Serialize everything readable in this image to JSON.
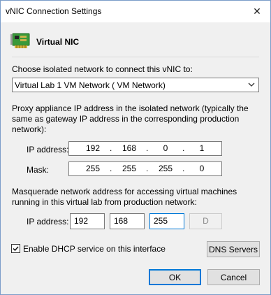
{
  "window": {
    "title": "vNIC Connection Settings",
    "close_glyph": "✕"
  },
  "header": {
    "title": "Virtual NIC",
    "icon": "network-card-icon"
  },
  "isolated_network": {
    "label": "Choose isolated network to connect this vNIC to:",
    "selected": "Virtual Lab 1 VM Network ( VM Network)"
  },
  "proxy": {
    "description": "Proxy appliance IP address in the isolated network (typically the same as gateway IP address in the corresponding production network):",
    "ip_label": "IP address:",
    "ip": [
      "192",
      "168",
      "0",
      "1"
    ],
    "mask_label": "Mask:",
    "mask": [
      "255",
      "255",
      "255",
      "0"
    ]
  },
  "masquerade": {
    "description": "Masquerade network address for accessing virtual machines running in this virtual lab from production network:",
    "ip_label": "IP address:",
    "octets": [
      "192",
      "168",
      "255",
      "D"
    ]
  },
  "dhcp": {
    "label": "Enable DHCP service on this interface",
    "checked": true
  },
  "buttons": {
    "dns": "DNS Servers",
    "ok": "OK",
    "cancel": "Cancel"
  },
  "colors": {
    "accent": "#0078d7",
    "card_green": "#3a9a3a"
  }
}
